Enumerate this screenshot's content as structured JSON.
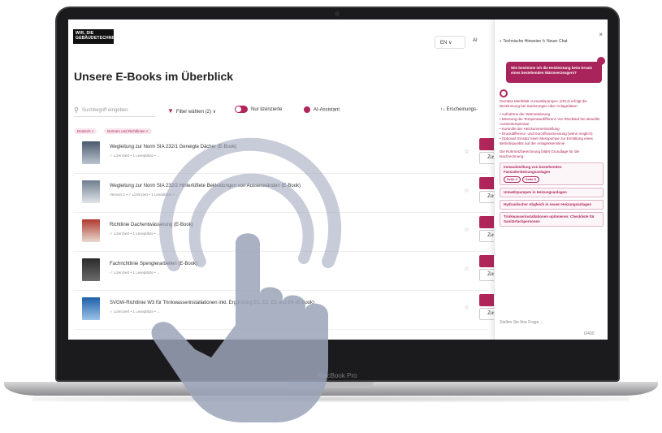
{
  "app": {
    "logo_line1": "WIR, DIE",
    "logo_line2": "GEBÄUDETECHNIKER",
    "language": "EN ∨",
    "ai_label": "AI",
    "page_title": "Unsere E-Books im Überblick"
  },
  "toolbar": {
    "search_placeholder": "Suchbegriff eingeben",
    "filter_label": "Filter wählen (2) ∨",
    "licensed_label": "Nur lizenzierte",
    "ai_assistant_label": "AI-Assistant",
    "sort_label": "↑↓ Erscheinungs-"
  },
  "chips": [
    "Deutsch ×",
    "Normen und Richtlinien ×"
  ],
  "books": [
    {
      "title": "Wegleitung zur Norm SIA 232/1 Geneigte Dächer (E-Book)",
      "meta": "✓ Lizenziert • 1 Leseplätze • ...",
      "read": "Jetzt lesen",
      "extra": "Zusätzlicher Leseplatz"
    },
    {
      "title": "Wegleitung zur Norm SIA 232/2 Hinterlüftete Bekleidungen von Aussenwänden (E-Book)",
      "meta": "Version 2 • ✓ Lizenziert • 1 Leseplätze • ...",
      "read": "Jetzt lesen",
      "extra": "Zusätzlicher Leseplatz"
    },
    {
      "title": "Richtlinie Dachentwässerung (E-Book)",
      "meta": "✓ Lizenziert • 1 Leseplätze • ...",
      "read": "Jetzt lesen",
      "extra": "Zusätzlicher Leseplatz"
    },
    {
      "title": "Fachrichtlinie Spenglerarbeiten (E-Book)",
      "meta": "✓ Lizenziert • 1 Leseplätze • ...",
      "read": "Jetzt lesen",
      "extra": "Zusätzlicher Leseplatz"
    },
    {
      "title": "SVGW-Richtlinie W3 für Trinkwasserinstallationen inkl. Ergänzung E1, E2, E3 und E4 (E-Book)",
      "meta": "✓ Lizenziert • 1 Leseplätze • ...",
      "read": "Jetzt lesen",
      "extra": "Zusätzlicher Leseplatz"
    }
  ],
  "chat": {
    "top_links": "◐ Technische Hinweise   ↻ Neuer Chat",
    "close": "×",
    "user_message": "Wie bestimme ich die Heizleistung beim Ersatz eines bestehenden Wärmeerzeugers?",
    "bot_intro": "Gemäss Merkblatt «Umwälzpumpe» (2014) erfolgt die Bestimmung bei Sanierungen über Anlagedaten:",
    "bot_points": [
      "Aufnahme der Wärmeleistung",
      "Messung der Temperaturdifferenz Vor-/Rücklauf bei aktueller Aussentemperatur",
      "Kontrolle der Heizkurveneinstellung",
      "Druckdifferenz- und Durchflussmessung (wenn möglich)",
      "Optional: Einsatz einer Messpumpe zur Ermittlung eines Betriebspunkts auf der Anlagenkennlinie"
    ],
    "bot_outro": "Die Rohrnetzberechnung bildet Grundlage für die Nachrechnung.",
    "sources": [
      "Instandstellung von bestehenden Fassadenheizungsanlagen",
      "Umwälzpumpen in Heizungsanlagen",
      "Hydraulischer Abgleich in neuen Heizungsanlagen",
      "Trinkwasserinstallationen optimieren: Checkliste für Sanitärfachpersonen"
    ],
    "tags": [
      "Seite 2",
      "Seite 5"
    ],
    "input_placeholder": "Stellen Sie Ihre Frage ...",
    "counter": "0/400"
  },
  "device": {
    "label": "MacBook Pro"
  },
  "colors": {
    "accent": "#b0265b",
    "overlay": "#9aa3b8"
  }
}
